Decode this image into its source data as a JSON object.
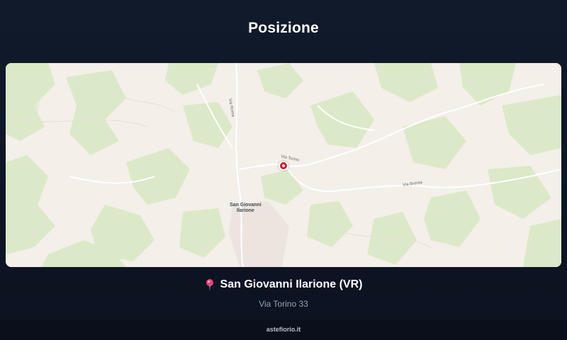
{
  "page": {
    "title": "Posizione"
  },
  "map": {
    "town_label": "San Giovanni\nIlarione",
    "road_labels": [
      "Via Torino",
      "Via Brenta",
      "Via Roma"
    ],
    "marker_color": "#c81e2e"
  },
  "location": {
    "pin_icon": "map-pin-icon",
    "place": "San Giovanni Ilarione (VR)",
    "address": "Via Torino 33"
  },
  "footer": {
    "site": "astefiorio.it"
  },
  "colors": {
    "background": "#0f1727",
    "map_land": "#f4efe8",
    "map_green": "#dbe9c8",
    "pin": "#e8457a"
  }
}
